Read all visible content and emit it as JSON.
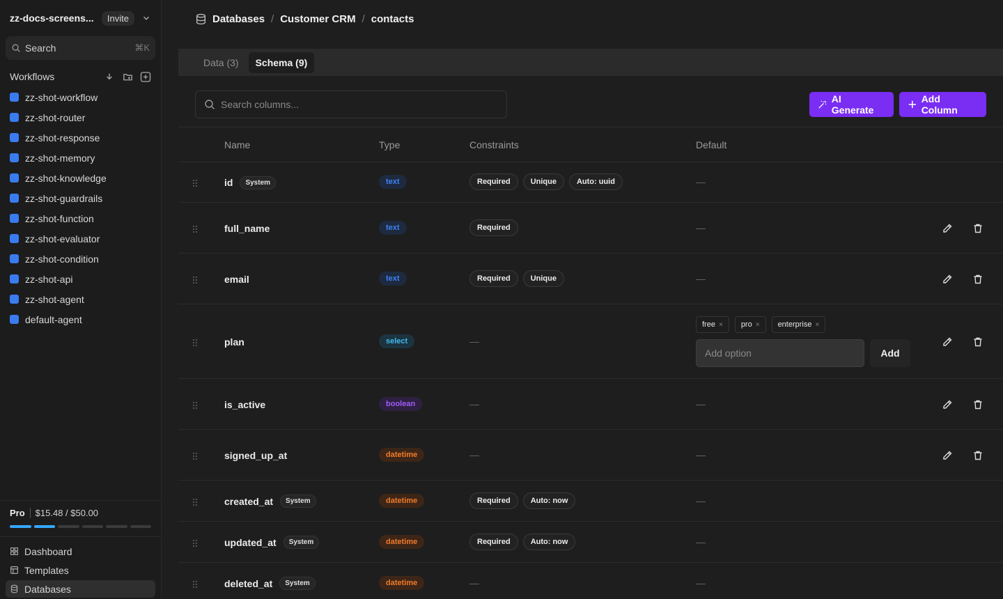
{
  "workspace": {
    "name": "zz-docs-screens...",
    "invite_label": "Invite"
  },
  "search": {
    "label": "Search",
    "shortcut": "⌘K"
  },
  "workflows": {
    "title": "Workflows",
    "items": [
      {
        "label": "zz-shot-workflow"
      },
      {
        "label": "zz-shot-router"
      },
      {
        "label": "zz-shot-response"
      },
      {
        "label": "zz-shot-memory"
      },
      {
        "label": "zz-shot-knowledge"
      },
      {
        "label": "zz-shot-guardrails"
      },
      {
        "label": "zz-shot-function"
      },
      {
        "label": "zz-shot-evaluator"
      },
      {
        "label": "zz-shot-condition"
      },
      {
        "label": "zz-shot-api"
      },
      {
        "label": "zz-shot-agent"
      },
      {
        "label": "default-agent"
      }
    ],
    "dot_color": "#3a7bf0"
  },
  "usage": {
    "plan": "Pro",
    "amount": "$15.48 / $50.00",
    "segments_filled": 2,
    "segments_total": 6
  },
  "bottom_nav": [
    {
      "label": "Dashboard",
      "icon": "dashboard-icon"
    },
    {
      "label": "Templates",
      "icon": "templates-icon"
    },
    {
      "label": "Databases",
      "icon": "database-icon",
      "active": true
    }
  ],
  "breadcrumb": {
    "items": [
      "Databases",
      "Customer CRM",
      "contacts"
    ],
    "separator": "/"
  },
  "tabs": [
    {
      "label": "Data (3)"
    },
    {
      "label": "Schema (9)",
      "active": true
    }
  ],
  "column_search": {
    "placeholder": "Search columns..."
  },
  "toolbar": {
    "ai_generate": "AI Generate",
    "add_column": "Add Column",
    "accent": "#7a2df3"
  },
  "table": {
    "headers": {
      "name": "Name",
      "type": "Type",
      "constraints": "Constraints",
      "default": "Default"
    },
    "empty": "—",
    "system_badge": "System",
    "rows": [
      {
        "name": "id",
        "system": true,
        "type": "text",
        "constraints": [
          "Required",
          "Unique",
          "Auto: uuid"
        ],
        "default": "—",
        "editable": false
      },
      {
        "name": "full_name",
        "system": false,
        "type": "text",
        "constraints": [
          "Required"
        ],
        "default": "—",
        "editable": true
      },
      {
        "name": "email",
        "system": false,
        "type": "text",
        "constraints": [
          "Required",
          "Unique"
        ],
        "default": "—",
        "editable": true
      },
      {
        "name": "plan",
        "system": false,
        "type": "select",
        "constraints": [],
        "default": null,
        "editable": true,
        "options": [
          "free",
          "pro",
          "enterprise"
        ],
        "option_placeholder": "Add option",
        "option_add": "Add"
      },
      {
        "name": "is_active",
        "system": false,
        "type": "boolean",
        "constraints": [],
        "default": "—",
        "editable": true
      },
      {
        "name": "signed_up_at",
        "system": false,
        "type": "datetime",
        "constraints": [],
        "default": "—",
        "editable": true
      },
      {
        "name": "created_at",
        "system": true,
        "type": "datetime",
        "constraints": [
          "Required",
          "Auto: now"
        ],
        "default": "—",
        "editable": false
      },
      {
        "name": "updated_at",
        "system": true,
        "type": "datetime",
        "constraints": [
          "Required",
          "Auto: now"
        ],
        "default": "—",
        "editable": false
      },
      {
        "name": "deleted_at",
        "system": true,
        "type": "datetime",
        "constraints": [],
        "default": "—",
        "editable": false
      }
    ],
    "type_colors": {
      "text": "#3f82f5",
      "select": "#3eb8ee",
      "boolean": "#a15cf7",
      "datetime": "#f07b2c"
    }
  }
}
